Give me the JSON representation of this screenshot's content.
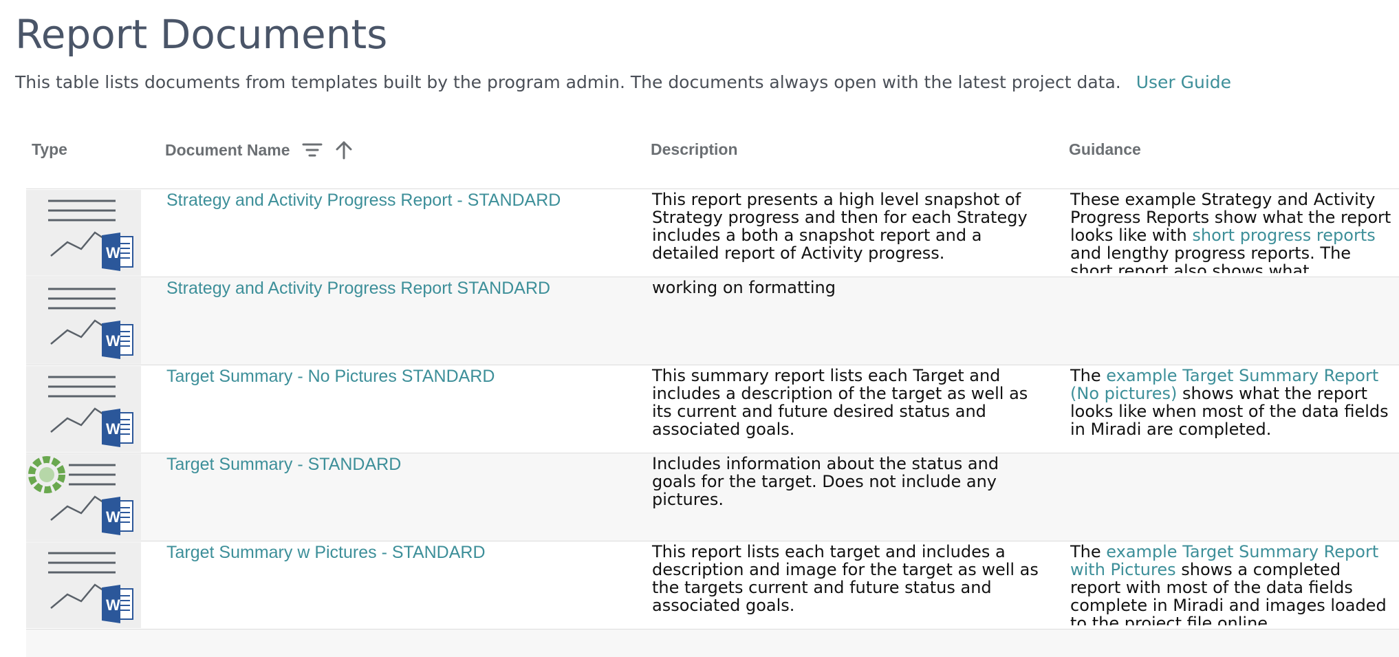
{
  "page": {
    "title": "Report Documents",
    "intro": "This table lists documents from templates built by the program admin. The documents always open with the latest project data.",
    "user_guide_label": "User Guide"
  },
  "table": {
    "headers": {
      "type": "Type",
      "document_name": "Document Name",
      "description": "Description",
      "guidance": "Guidance"
    },
    "rows": [
      {
        "icon": "word-report-icon",
        "name": "Strategy and Activity Progress Report - STANDARD",
        "description": "This report presents a high level snapshot of Strategy progress and then for each Strategy includes a both a snapshot report and a detailed report of Activity progress.",
        "guidance": {
          "pre": "These example Strategy and Activity Progress Reports show what the report looks like with ",
          "link": "short progress reports",
          "post": " and lengthy progress reports. The short report also shows what"
        }
      },
      {
        "icon": "word-report-icon",
        "name": "Strategy and Activity Progress Report STANDARD",
        "description": "working on formatting",
        "guidance": {
          "pre": "",
          "link": "",
          "post": ""
        }
      },
      {
        "icon": "word-report-icon",
        "name": "Target Summary - No Pictures STANDARD",
        "description": "This summary report lists each Target and includes a description of the target as well as its current and future desired status and associated goals.",
        "guidance": {
          "pre": "The ",
          "link": "example Target Summary Report (No pictures)",
          "post": " shows what the report looks like when most of the data fields in Miradi are completed."
        }
      },
      {
        "icon": "target-word-report-icon",
        "name": "Target Summary - STANDARD",
        "description": "Includes information about the status and goals for the target. Does not include any pictures.",
        "guidance": {
          "pre": "",
          "link": "",
          "post": ""
        }
      },
      {
        "icon": "word-report-icon",
        "name": "Target Summary w Pictures - STANDARD",
        "description": "This report lists each target and includes a description and image for the target as well as the targets current and future status and associated goals.",
        "guidance": {
          "pre": "The ",
          "link": "example Target Summary Report with Pictures",
          "post": " shows a completed report with most of the data fields complete in Miradi and images loaded to the project file online."
        }
      }
    ]
  },
  "colors": {
    "link": "#3d8f99",
    "title": "#4a5568",
    "word_blue": "#2b579a",
    "row_border": "#dcdcdc"
  }
}
